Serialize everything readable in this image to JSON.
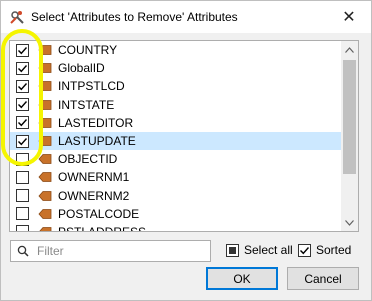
{
  "window": {
    "title": "Select 'Attributes to Remove' Attributes",
    "close_glyph": "✕"
  },
  "attributes": [
    {
      "label": "COUNTRY",
      "checked": true,
      "selected": false
    },
    {
      "label": "GlobalID",
      "checked": true,
      "selected": false
    },
    {
      "label": "INTPSTLCD",
      "checked": true,
      "selected": false
    },
    {
      "label": "INTSTATE",
      "checked": true,
      "selected": false
    },
    {
      "label": "LASTEDITOR",
      "checked": true,
      "selected": false
    },
    {
      "label": "LASTUPDATE",
      "checked": true,
      "selected": true
    },
    {
      "label": "OBJECTID",
      "checked": false,
      "selected": false
    },
    {
      "label": "OWNERNM1",
      "checked": false,
      "selected": false
    },
    {
      "label": "OWNERNM2",
      "checked": false,
      "selected": false
    },
    {
      "label": "POSTALCODE",
      "checked": false,
      "selected": false
    },
    {
      "label": "PSTLADDRESS",
      "checked": false,
      "selected": false
    }
  ],
  "filter": {
    "placeholder": "Filter",
    "value": ""
  },
  "options": {
    "select_all_label": "Select all",
    "select_all_state": "partial",
    "sorted_label": "Sorted",
    "sorted_checked": true
  },
  "buttons": {
    "ok_label": "OK",
    "cancel_label": "Cancel"
  },
  "colors": {
    "selection": "#cce8ff",
    "attribute_icon": "#c8722a",
    "highlight": "#f5f500",
    "ok_border": "#0078d7"
  },
  "icons": {
    "app": "transformer-icon",
    "attribute": "attribute-tag-icon",
    "filter": "search-icon",
    "scroll_up": "chevron-up-icon",
    "scroll_down": "chevron-down-icon"
  }
}
